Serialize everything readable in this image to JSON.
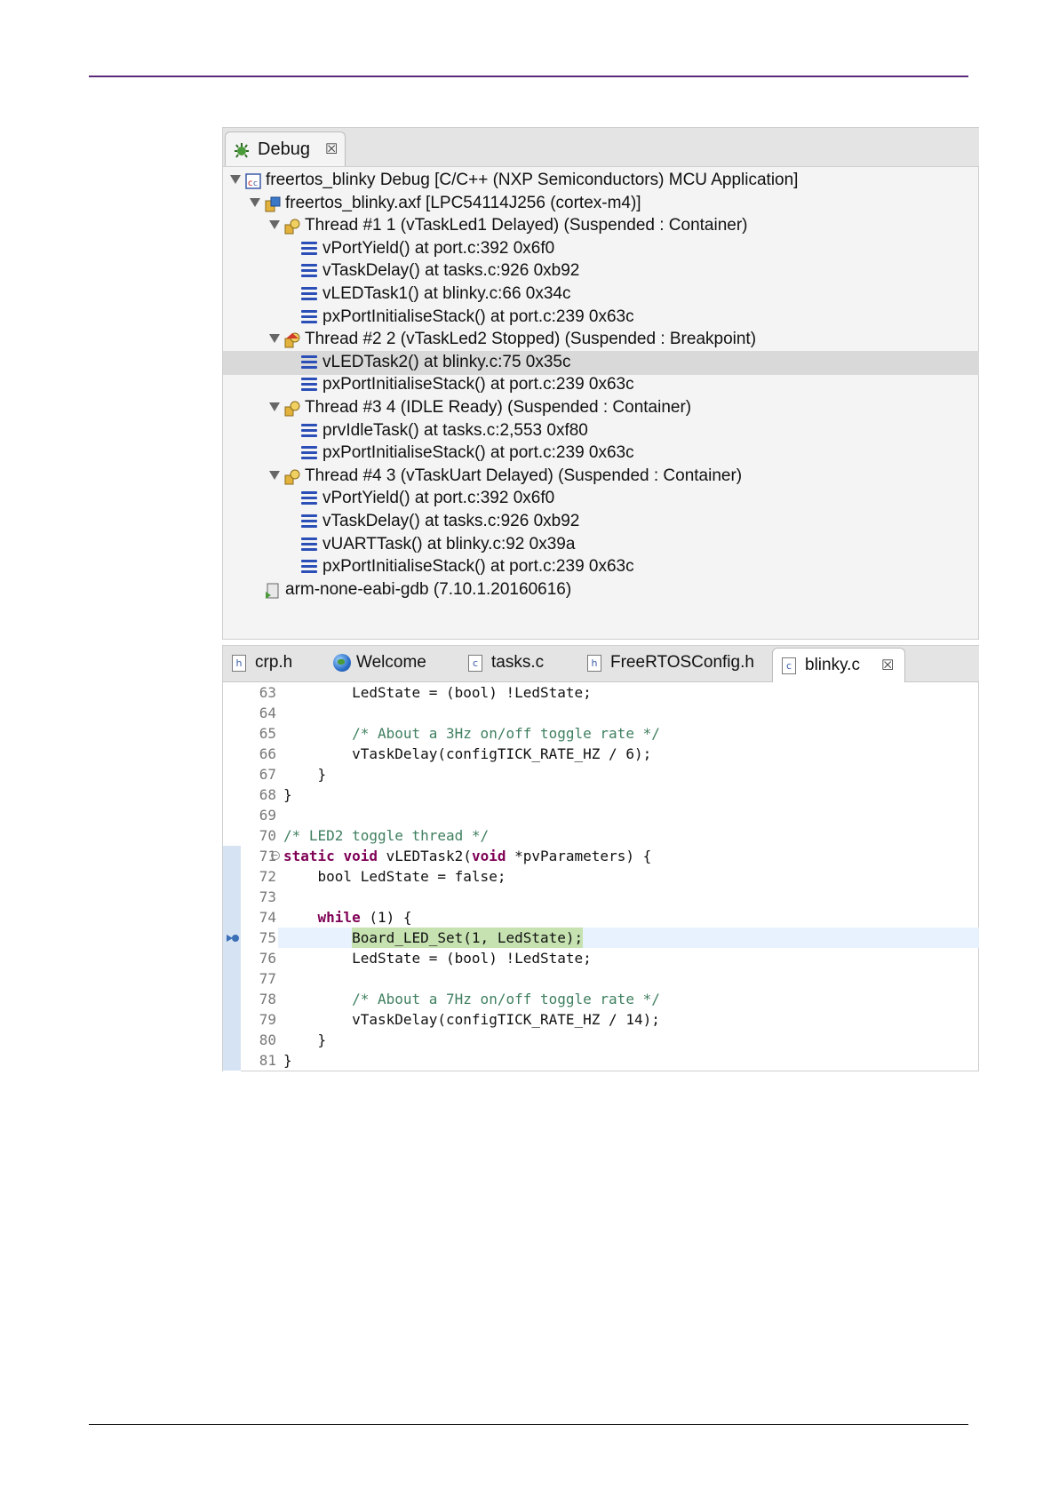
{
  "debug_view": {
    "tab_label": "Debug",
    "tab_close": "☒",
    "tree": [
      {
        "text": "freertos_blinky Debug [C/C++ (NXP Semiconductors) MCU Application]",
        "kind": "launch",
        "level": 0
      },
      {
        "text": "freertos_blinky.axf [LPC54114J256 (cortex-m4)]",
        "kind": "process",
        "level": 1
      },
      {
        "text": "Thread #1 1 (vTaskLed1 Delayed) (Suspended : Container)",
        "kind": "thread",
        "level": 2
      },
      {
        "text": "vPortYield() at port.c:392 0x6f0",
        "kind": "frame",
        "level": 3
      },
      {
        "text": "vTaskDelay() at tasks.c:926 0xb92",
        "kind": "frame",
        "level": 3
      },
      {
        "text": "vLEDTask1() at blinky.c:66 0x34c",
        "kind": "frame",
        "level": 3
      },
      {
        "text": "pxPortInitialiseStack() at port.c:239 0x63c",
        "kind": "frame",
        "level": 3
      },
      {
        "text": "Thread #2 2 (vTaskLed2 Stopped) (Suspended : Breakpoint)",
        "kind": "thread-break",
        "level": 2
      },
      {
        "text": "vLEDTask2() at blinky.c:75 0x35c",
        "kind": "frame",
        "level": 3,
        "selected": true
      },
      {
        "text": "pxPortInitialiseStack() at port.c:239 0x63c",
        "kind": "frame",
        "level": 3
      },
      {
        "text": "Thread #3 4 (IDLE Ready) (Suspended : Container)",
        "kind": "thread",
        "level": 2
      },
      {
        "text": "prvIdleTask() at tasks.c:2,553 0xf80",
        "kind": "frame",
        "level": 3
      },
      {
        "text": "pxPortInitialiseStack() at port.c:239 0x63c",
        "kind": "frame",
        "level": 3
      },
      {
        "text": "Thread #4 3 (vTaskUart Delayed) (Suspended : Container)",
        "kind": "thread",
        "level": 2
      },
      {
        "text": "vPortYield() at port.c:392 0x6f0",
        "kind": "frame",
        "level": 3
      },
      {
        "text": "vTaskDelay() at tasks.c:926 0xb92",
        "kind": "frame",
        "level": 3
      },
      {
        "text": "vUARTTask() at blinky.c:92 0x39a",
        "kind": "frame",
        "level": 3
      },
      {
        "text": "pxPortInitialiseStack() at port.c:239 0x63c",
        "kind": "frame",
        "level": 3
      },
      {
        "text": "arm-none-eabi-gdb (7.10.1.20160616)",
        "kind": "gdb",
        "level": 1
      }
    ]
  },
  "editor": {
    "tabs": [
      {
        "label": "crp.h",
        "icon": "h-file-icon",
        "active": false
      },
      {
        "label": "Welcome",
        "icon": "globe-icon",
        "active": false
      },
      {
        "label": "tasks.c",
        "icon": "c-file-icon",
        "active": false
      },
      {
        "label": "FreeRTOSConfig.h",
        "icon": "h-file-icon",
        "active": false
      },
      {
        "label": "blinky.c",
        "icon": "c-file-icon",
        "active": true,
        "close": "☒"
      }
    ],
    "lines": [
      {
        "n": "63",
        "code": "        LedState = (bool) !LedState;"
      },
      {
        "n": "64",
        "code": ""
      },
      {
        "n": "65",
        "code": "        /* About a 3Hz on/off toggle rate */"
      },
      {
        "n": "66",
        "code": "        vTaskDelay(configTICK_RATE_HZ / 6);"
      },
      {
        "n": "67",
        "code": "    }"
      },
      {
        "n": "68",
        "code": "}"
      },
      {
        "n": "69",
        "code": ""
      },
      {
        "n": "70",
        "code": "/* LED2 toggle thread */"
      },
      {
        "n": "71",
        "code": "static void vLEDTask2(void *pvParameters) {"
      },
      {
        "n": "72",
        "code": "    bool LedState = false;"
      },
      {
        "n": "73",
        "code": ""
      },
      {
        "n": "74",
        "code": "    while (1) {"
      },
      {
        "n": "75",
        "code": "        Board_LED_Set(1, LedState);"
      },
      {
        "n": "76",
        "code": "        LedState = (bool) !LedState;"
      },
      {
        "n": "77",
        "code": ""
      },
      {
        "n": "78",
        "code": "        /* About a 7Hz on/off toggle rate */"
      },
      {
        "n": "79",
        "code": "        vTaskDelay(configTICK_RATE_HZ / 14);"
      },
      {
        "n": "80",
        "code": "    }"
      },
      {
        "n": "81",
        "code": "}"
      }
    ],
    "current_line": "75"
  },
  "colors": {
    "accent_rule": "#5b2a7a",
    "selection": "#d9d9d9",
    "current_line_code": "#c6e2b1",
    "keyword": "#7f0055",
    "comment": "#3f7f5f"
  }
}
